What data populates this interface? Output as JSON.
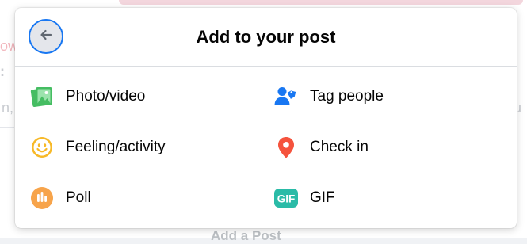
{
  "dialog": {
    "title": "Add to your post",
    "back_icon": "arrow-left-icon"
  },
  "options": [
    {
      "label": "Photo/video",
      "icon": "photo-video-icon",
      "color": "#45bd62"
    },
    {
      "label": "Tag people",
      "icon": "tag-people-icon",
      "color": "#1877f2"
    },
    {
      "label": "Feeling/activity",
      "icon": "feeling-icon",
      "color": "#f7b928"
    },
    {
      "label": "Check in",
      "icon": "location-pin-icon",
      "color": "#f5533d"
    },
    {
      "label": "Poll",
      "icon": "poll-icon",
      "color": "#f7a44b"
    },
    {
      "label": "GIF",
      "icon": "gif-icon",
      "color": "#2abba7"
    }
  ],
  "background": {
    "bottom_text": "Add a Post"
  },
  "colors": {
    "accent": "#1877f2",
    "text": "#050505",
    "divider": "#dadde1"
  }
}
